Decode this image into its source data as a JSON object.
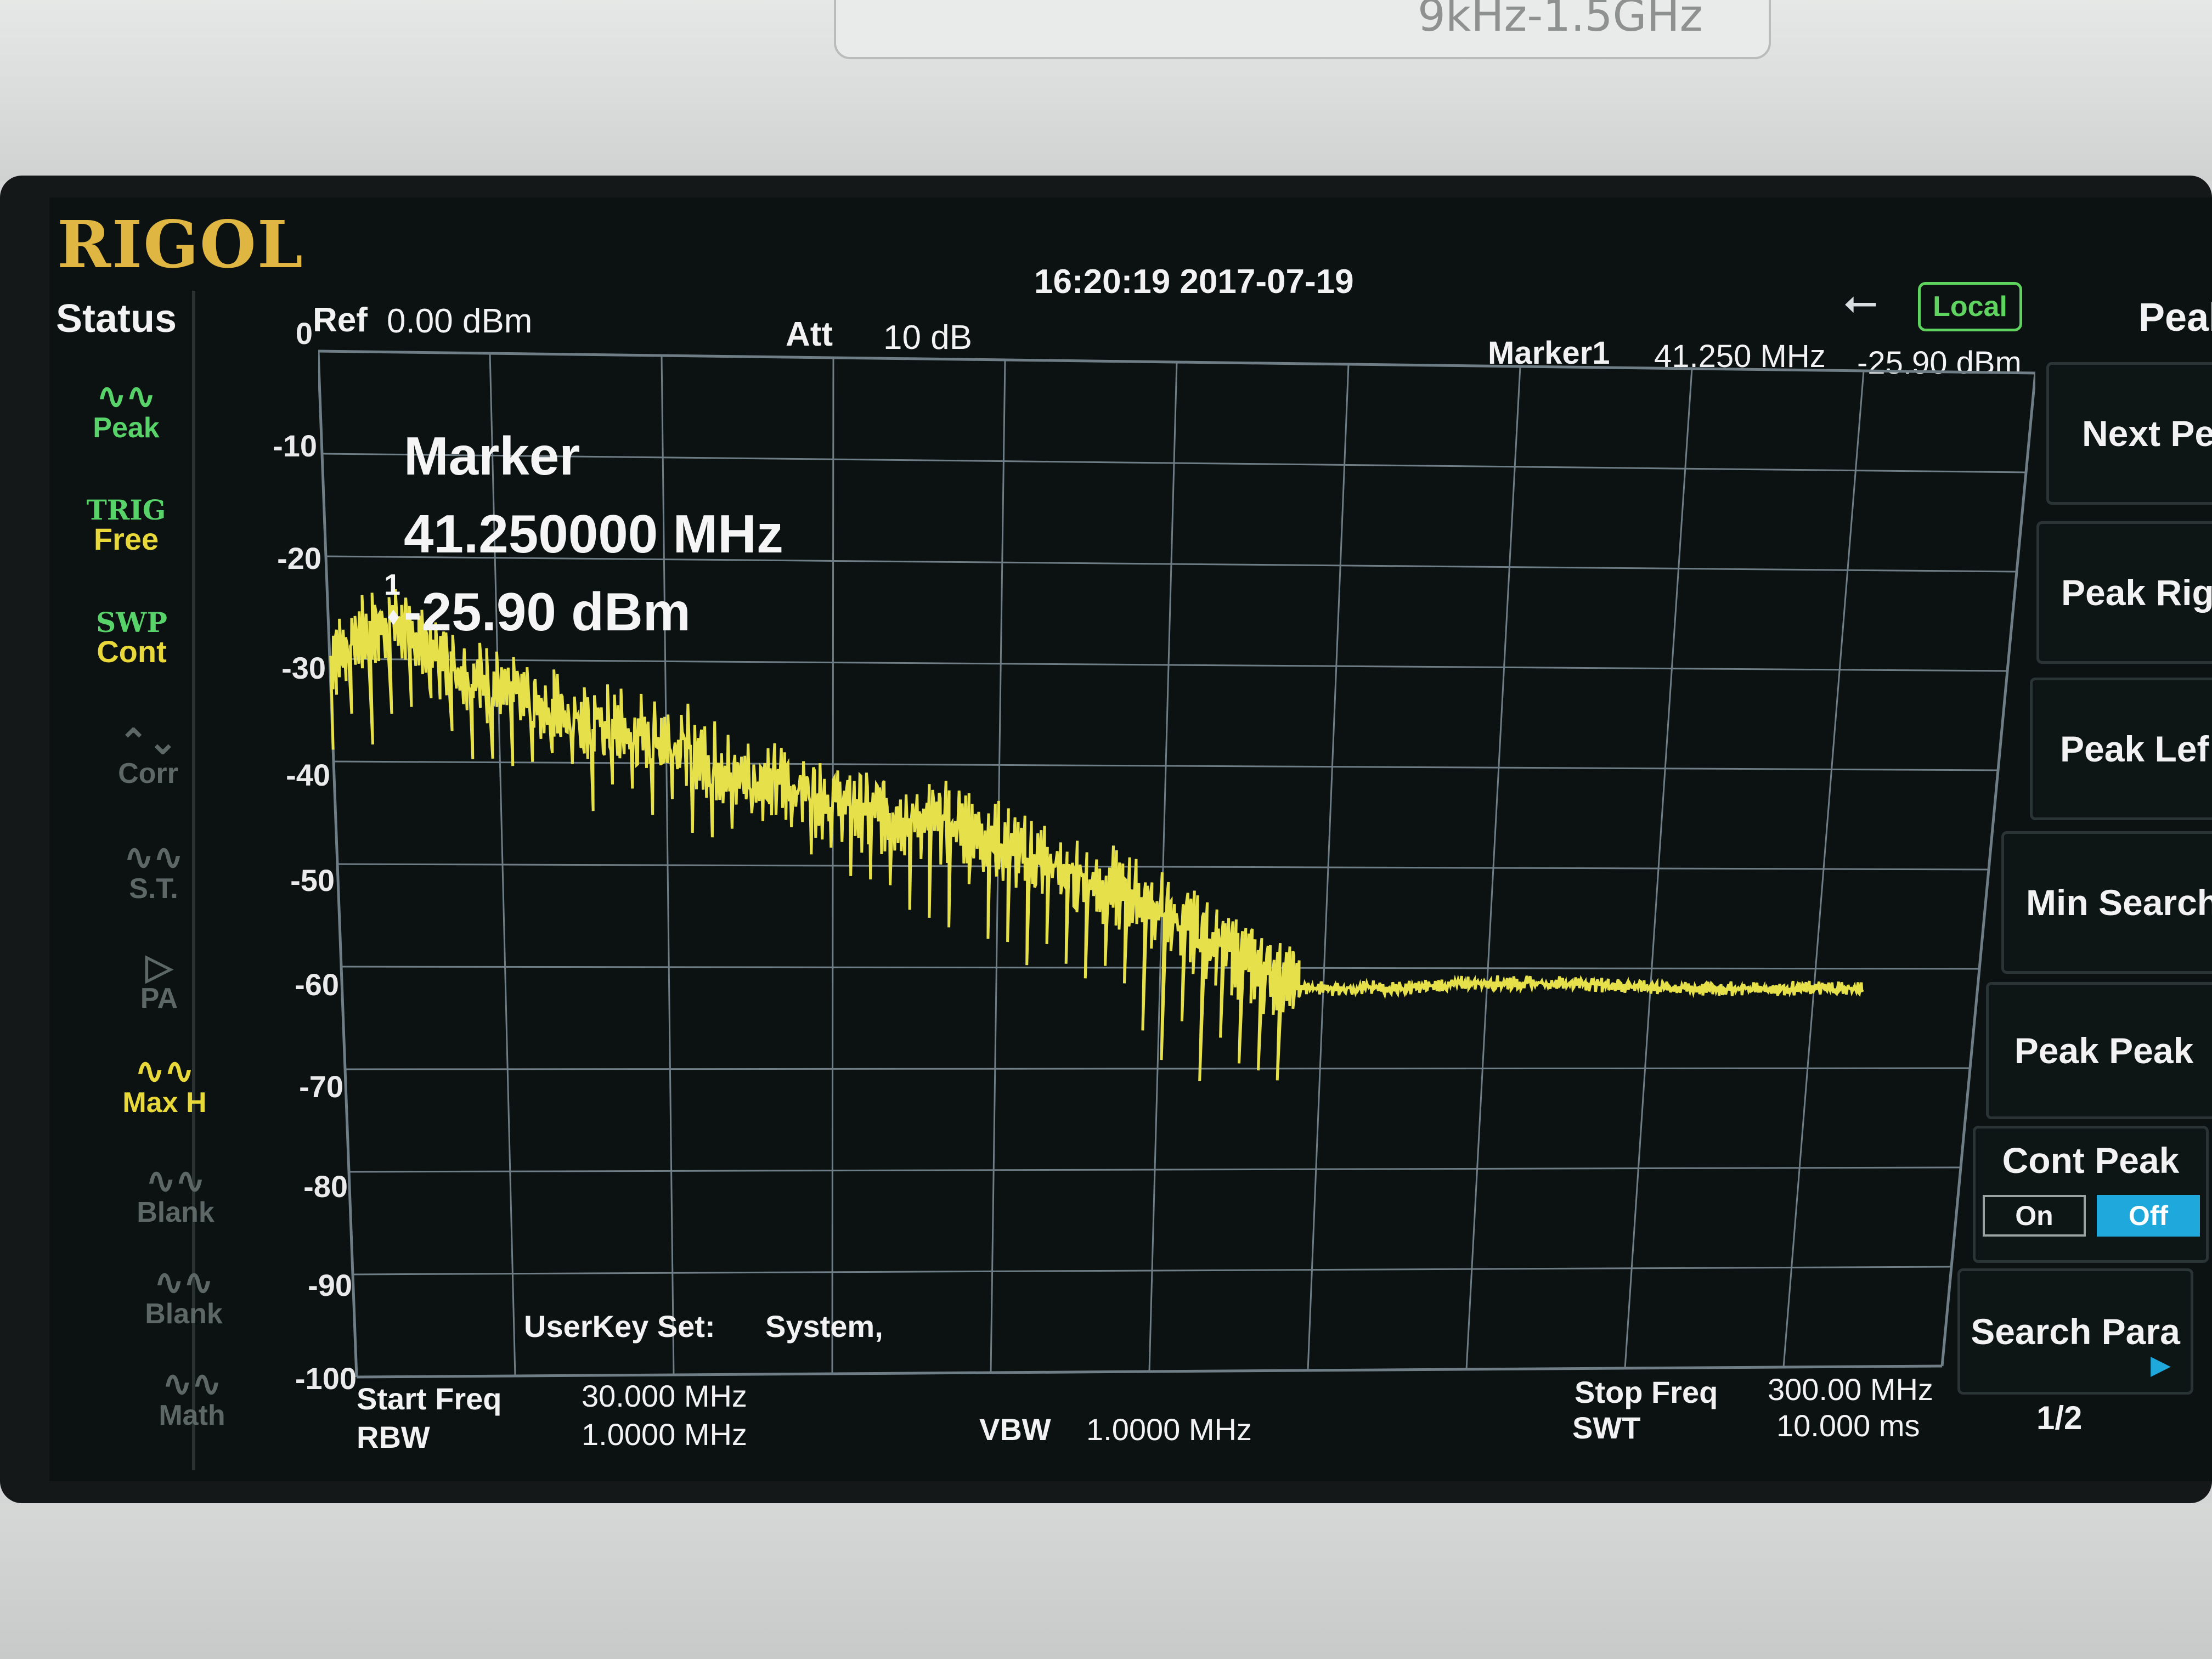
{
  "device": {
    "model_label": "9kHz-1.5GHz",
    "brand": "RIGOL"
  },
  "header": {
    "datetime": "16:20:19 2017-07-19",
    "ref_label": "Ref",
    "ref_value": "0.00 dBm",
    "att_label": "Att",
    "att_value": "10 dB",
    "marker_label": "Marker1",
    "marker_freq": "41.250 MHz",
    "marker_level": "-25.90 dBm",
    "remote_state": "Local"
  },
  "status": {
    "title": "Status",
    "items": [
      {
        "top": "Peak",
        "bottom": ""
      },
      {
        "top": "TRIG",
        "bottom": "Free"
      },
      {
        "top": "SWP",
        "bottom": "Cont"
      },
      {
        "top": "",
        "bottom": "Corr"
      },
      {
        "top": "",
        "bottom": "S.T."
      },
      {
        "top": "",
        "bottom": "PA"
      },
      {
        "top": "",
        "bottom": "Max H"
      },
      {
        "top": "",
        "bottom": "Blank"
      },
      {
        "top": "",
        "bottom": "Blank"
      },
      {
        "top": "",
        "bottom": "Math"
      }
    ]
  },
  "marker_panel": {
    "title": "Marker",
    "freq": "41.250000 MHz",
    "level": "-25.90 dBm",
    "marker_number": "1"
  },
  "footer": {
    "userkey_label": "UserKey Set:",
    "userkey_value": "System,",
    "start_label": "Start Freq",
    "start_value": "30.000 MHz",
    "rbw_label": "RBW",
    "rbw_value": "1.0000 MHz",
    "vbw_label": "VBW",
    "vbw_value": "1.0000 MHz",
    "stop_label": "Stop Freq",
    "stop_value": "300.00 MHz",
    "swt_label": "SWT",
    "swt_value": "10.000 ms"
  },
  "softkeys": {
    "title": "Peak",
    "items": [
      "Next Pe",
      "Peak Rig",
      "Peak Lef",
      "Min Search",
      "Peak Peak"
    ],
    "cont_peak": {
      "label": "Cont Peak",
      "on": "On",
      "off": "Off",
      "state": "Off"
    },
    "search_para": "Search Para",
    "page": "1/2"
  },
  "chart_data": {
    "type": "line",
    "title": "",
    "xlabel": "",
    "ylabel": "",
    "x_unit": "MHz",
    "y_unit": "dBm",
    "xlim": [
      30,
      300
    ],
    "ylim": [
      -100,
      0
    ],
    "y_ticks": [
      "0",
      "-10",
      "-20",
      "-30",
      "-40",
      "-50",
      "-60",
      "-70",
      "-80",
      "-90",
      "-100"
    ],
    "grid": true,
    "trace_color": "#e6e04a",
    "grid_color": "#6f7d86",
    "series": [
      {
        "name": "",
        "x": [
          30,
          35,
          41.25,
          50,
          60,
          70,
          80,
          90,
          100,
          110,
          120,
          130,
          140,
          150,
          160,
          170,
          180,
          190,
          200,
          210,
          220,
          230,
          240,
          250,
          260,
          270,
          280,
          290,
          300
        ],
        "y": [
          -30,
          -28,
          -25.9,
          -30,
          -33,
          -35,
          -37,
          -38,
          -41,
          -42,
          -44,
          -45,
          -46,
          -49,
          -51,
          -53,
          -56,
          -59,
          -62,
          -62,
          -62,
          -61.5,
          -61.5,
          -61.5,
          -61.8,
          -62,
          -62,
          -62,
          -62
        ]
      }
    ]
  }
}
